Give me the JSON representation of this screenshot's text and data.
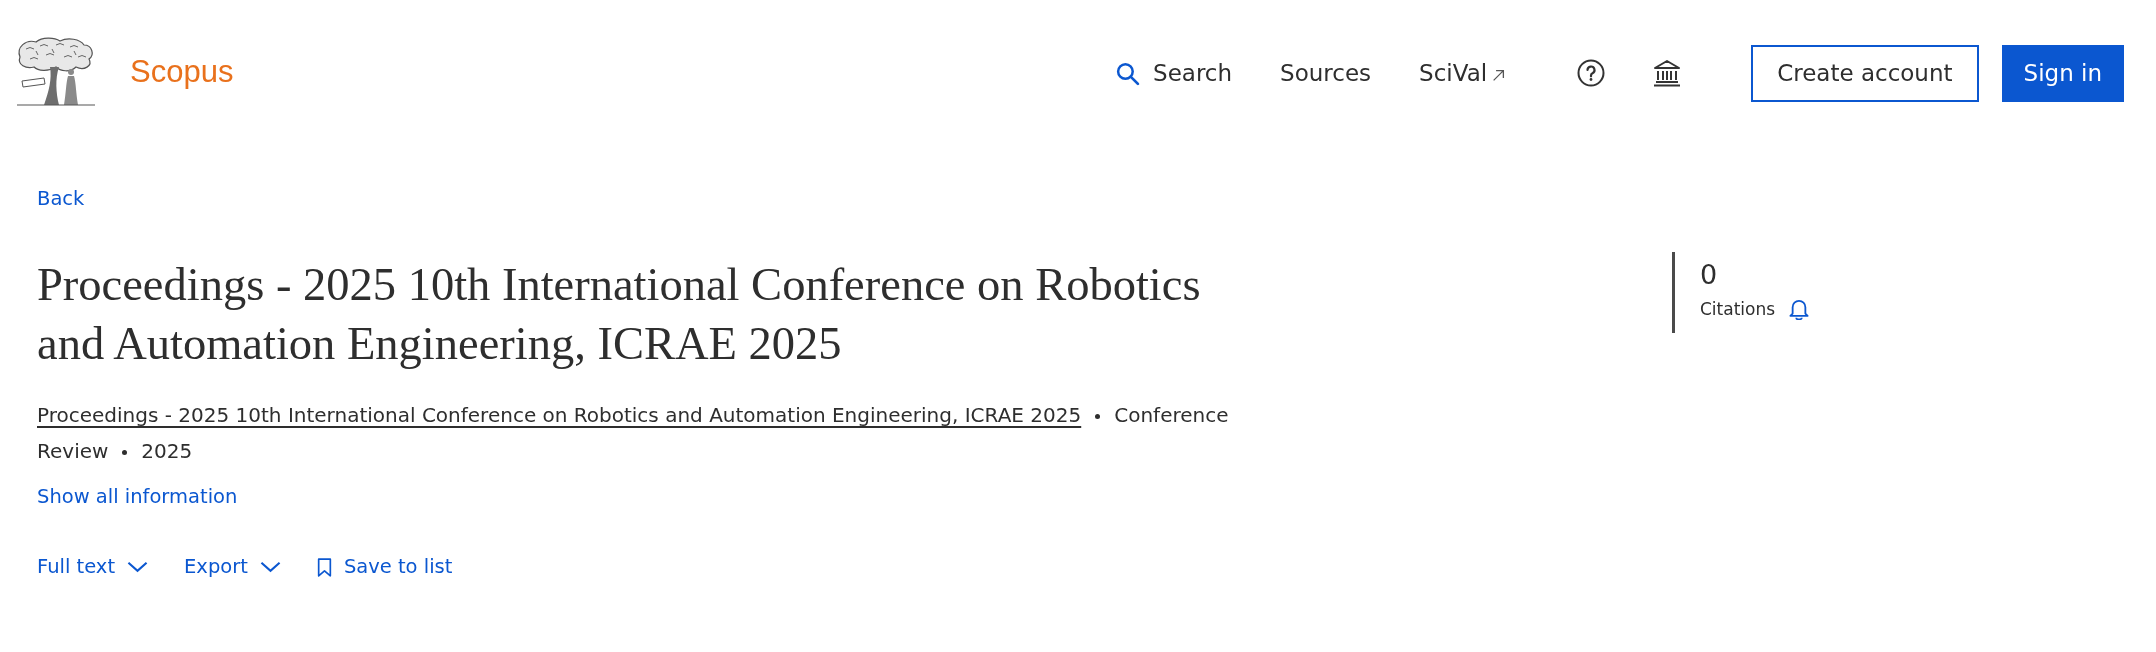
{
  "header": {
    "logo_text": "Scopus",
    "nav": [
      {
        "label": "Search",
        "kind": "search"
      },
      {
        "label": "Sources",
        "kind": "link"
      },
      {
        "label": "SciVal",
        "kind": "external"
      }
    ],
    "icon_buttons": [
      {
        "kind": "help"
      },
      {
        "kind": "institution"
      }
    ],
    "buttons": [
      {
        "label": "Create account",
        "kind": "outline"
      },
      {
        "label": "Sign in",
        "kind": "primary"
      }
    ]
  },
  "back_link": "Back",
  "document": {
    "title": "Proceedings - 2025 10th International Conference on Robotics and Automation Engineering, ICRAE 2025",
    "source": "Proceedings - 2025 10th International Conference on Robotics and Automation Engineering, ICRAE 2025",
    "details": [
      "Conference Review",
      "2025"
    ],
    "show_all": "Show all information"
  },
  "actions": [
    {
      "label": "Full text",
      "kind": "dropdown"
    },
    {
      "label": "Export",
      "kind": "dropdown"
    },
    {
      "label": "Save to list",
      "kind": "bookmark"
    }
  ],
  "metrics": {
    "count": "0",
    "label": "Citations"
  }
}
